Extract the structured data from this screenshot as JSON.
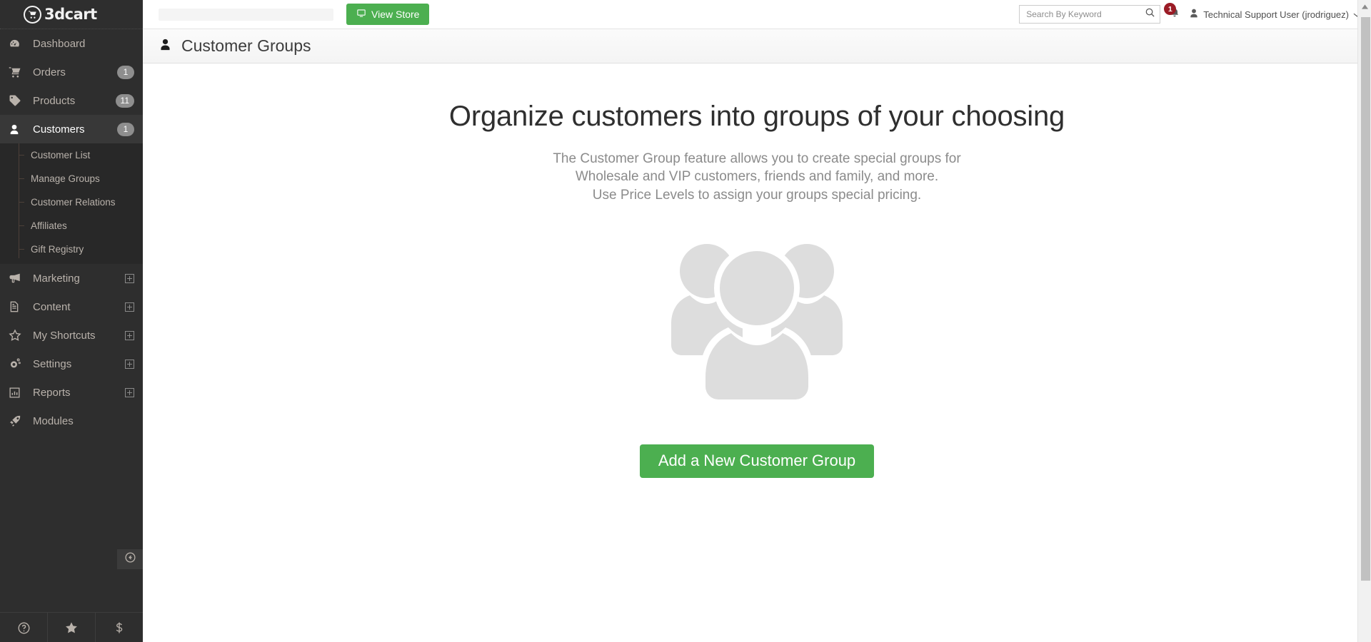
{
  "brand": {
    "logo_text": "3dcart",
    "logo_icon": "shopping-cart-icon",
    "accent_green": "#4caf50",
    "sidebar_bg": "#2e2e2e",
    "badge_red": "#9b1c26"
  },
  "sidebar": {
    "items": [
      {
        "label": "Dashboard",
        "icon": "dashboard-icon",
        "badge": "",
        "expandable": false,
        "active": false
      },
      {
        "label": "Orders",
        "icon": "cart-icon",
        "badge": "1",
        "expandable": false,
        "active": false
      },
      {
        "label": "Products",
        "icon": "tag-icon",
        "badge": "11",
        "expandable": false,
        "active": false
      },
      {
        "label": "Customers",
        "icon": "user-icon",
        "badge": "1",
        "expandable": false,
        "active": true
      },
      {
        "label": "Marketing",
        "icon": "megaphone-icon",
        "badge": "",
        "expandable": true,
        "active": false
      },
      {
        "label": "Content",
        "icon": "document-icon",
        "badge": "",
        "expandable": true,
        "active": false
      },
      {
        "label": "My Shortcuts",
        "icon": "star-icon",
        "badge": "",
        "expandable": true,
        "active": false
      },
      {
        "label": "Settings",
        "icon": "gears-icon",
        "badge": "",
        "expandable": true,
        "active": false
      },
      {
        "label": "Reports",
        "icon": "bar-chart-icon",
        "badge": "",
        "expandable": true,
        "active": false
      },
      {
        "label": "Modules",
        "icon": "rocket-icon",
        "badge": "",
        "expandable": false,
        "active": false
      }
    ],
    "submenu": {
      "parent": "Customers",
      "items": [
        {
          "label": "Customer List"
        },
        {
          "label": "Manage Groups"
        },
        {
          "label": "Customer Relations"
        },
        {
          "label": "Affiliates"
        },
        {
          "label": "Gift Registry"
        }
      ]
    },
    "collapse_icon": "circle-arrow-left-icon",
    "footer_icons": [
      {
        "name": "help-circle-icon",
        "glyph": "?"
      },
      {
        "name": "star-icon",
        "glyph": "★"
      },
      {
        "name": "dollar-icon",
        "glyph": "$"
      }
    ]
  },
  "topbar": {
    "view_store_label": "View Store",
    "view_store_icon": "monitor-icon",
    "search": {
      "placeholder": "Search By Keyword",
      "value": "",
      "icon": "search-icon"
    },
    "notifications": {
      "icon": "bell-icon",
      "count": "1"
    },
    "user": {
      "icon": "user-avatar-icon",
      "name": "Technical Support User (jrodriguez)",
      "chevron": "chevron-down-icon"
    }
  },
  "page": {
    "title": "Customer Groups",
    "title_icon": "user-icon"
  },
  "hero": {
    "heading": "Organize customers into groups of your choosing",
    "description_line1": "The Customer Group feature allows you to create special groups for",
    "description_line2": "Wholesale and VIP customers, friends and family, and more.",
    "description_line3": "Use Price Levels to assign your groups special pricing.",
    "illustration": "users-group-icon",
    "cta_label": "Add a New Customer Group"
  }
}
